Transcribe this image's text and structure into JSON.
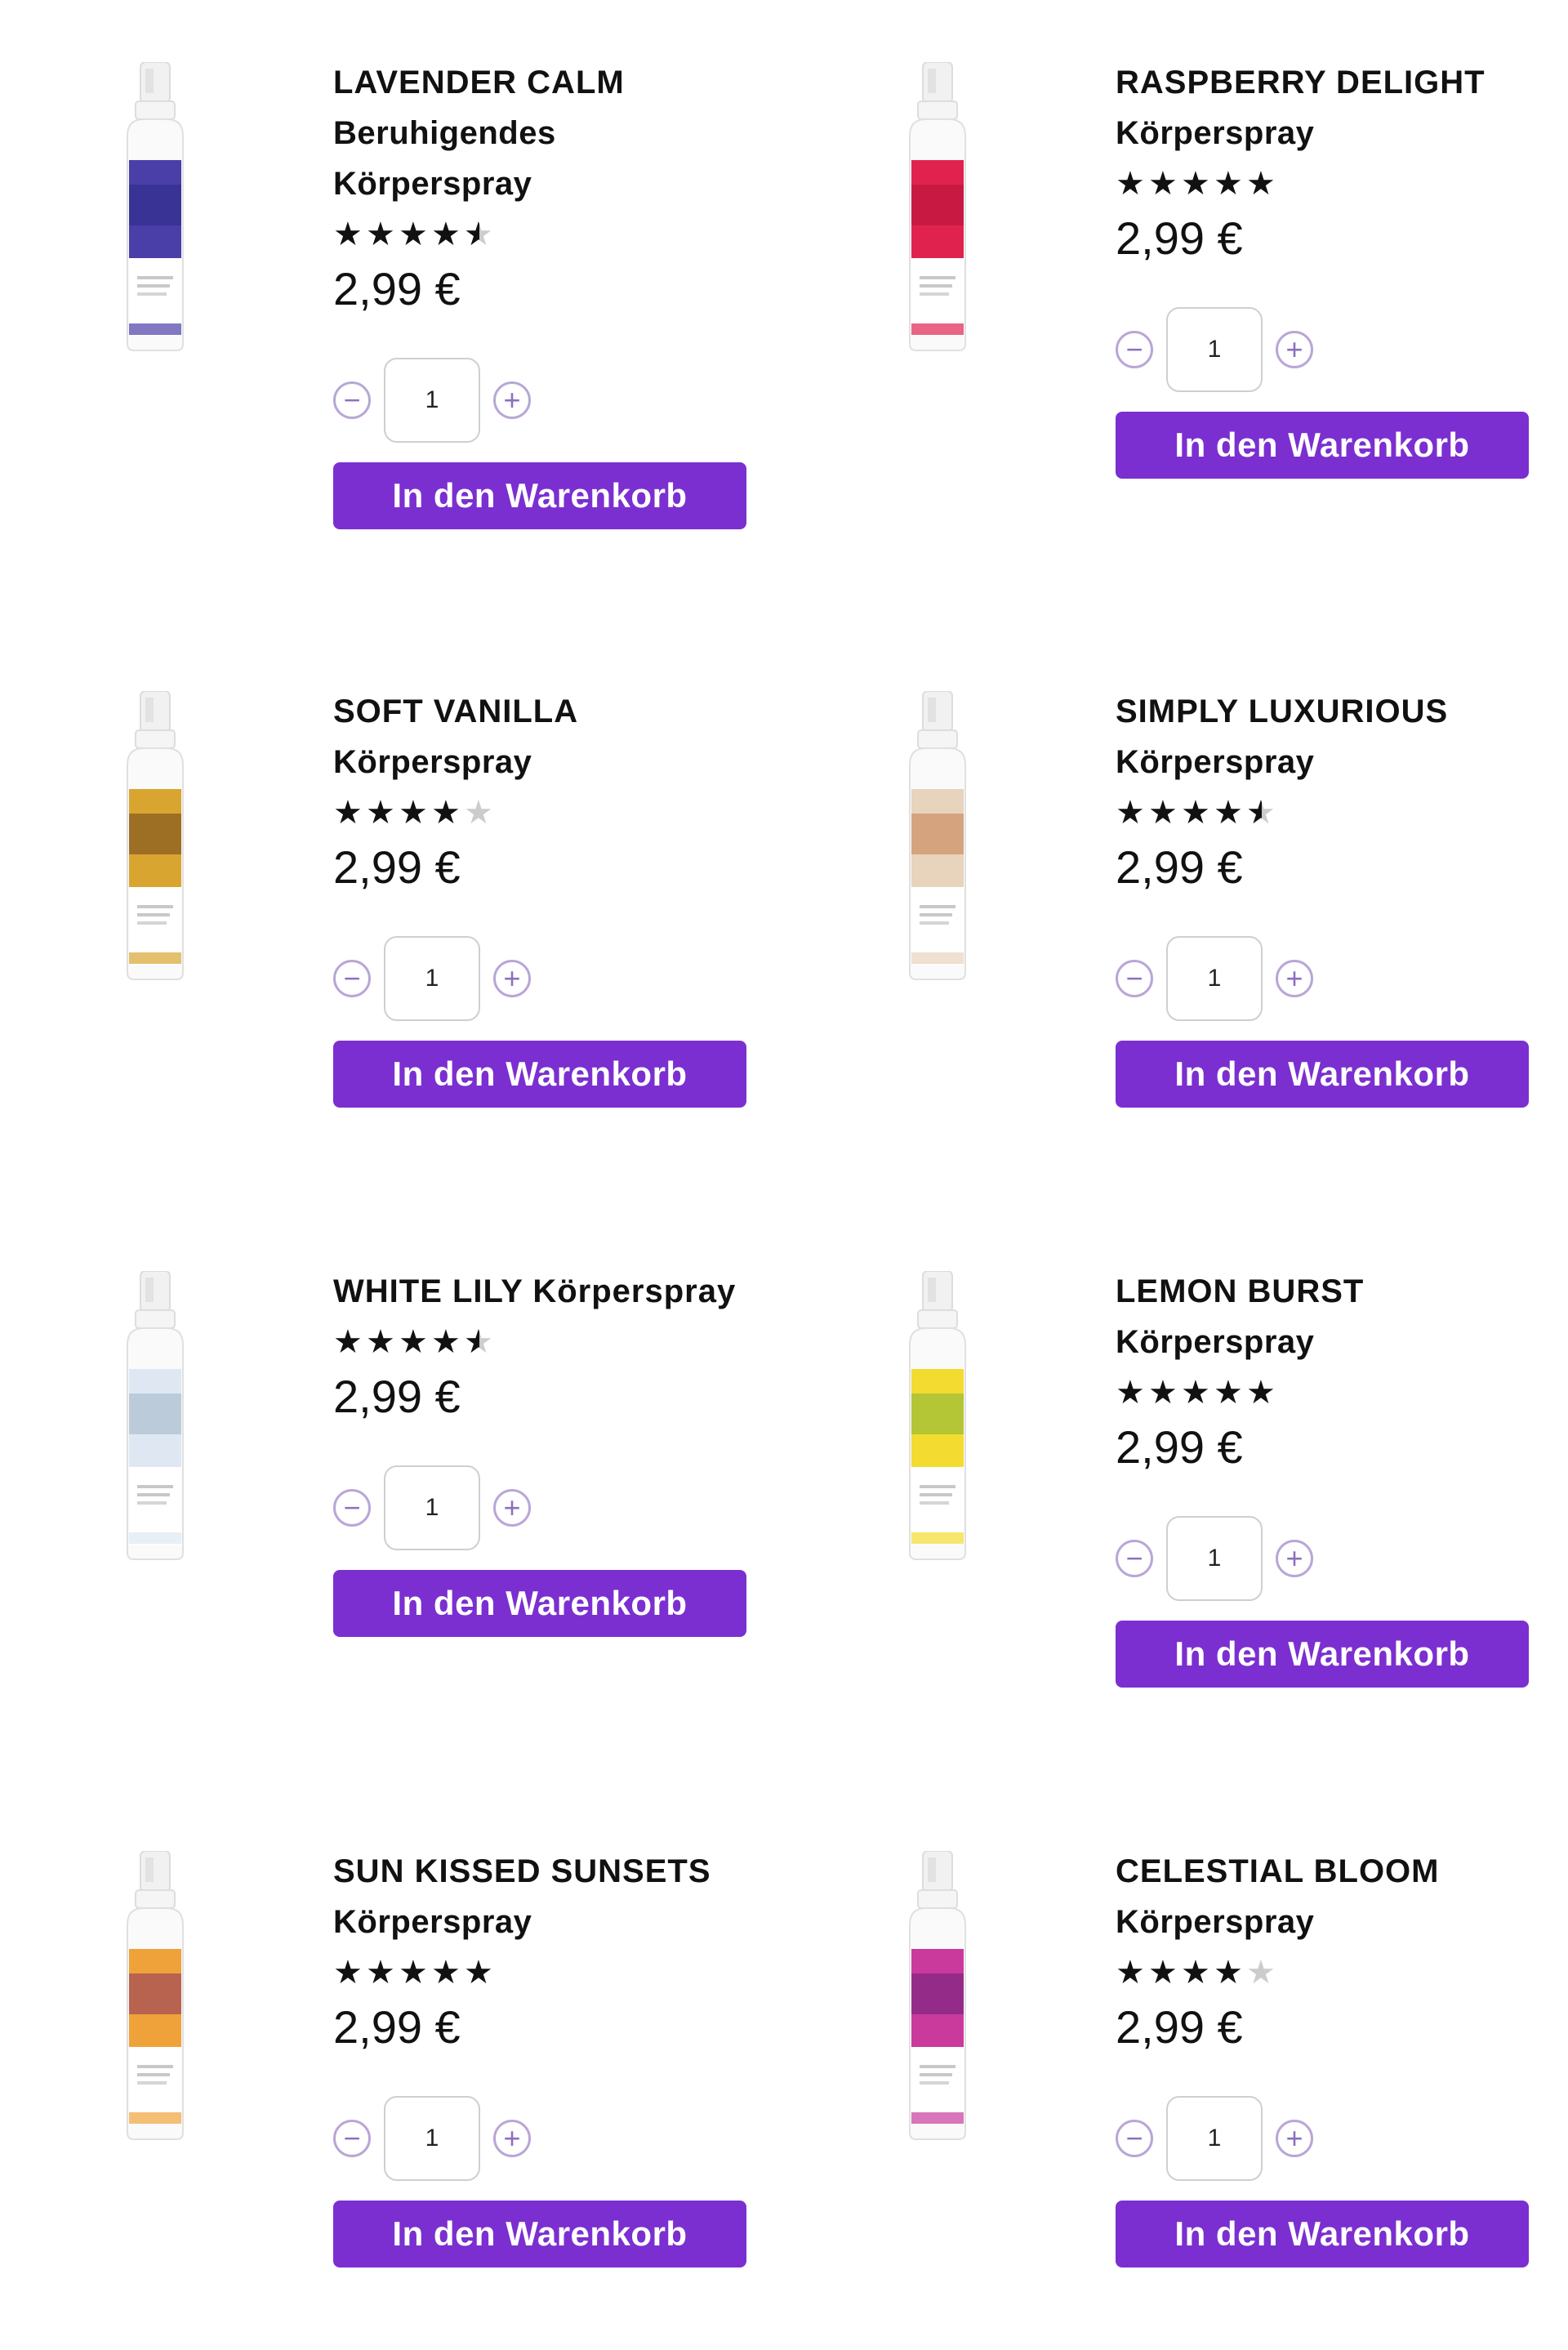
{
  "products": [
    {
      "name": "LAVENDER CALM",
      "subtitle_lines": [
        "Beruhigendes",
        "Körperspray"
      ],
      "rating": 4.5,
      "price": "2,99 €",
      "quantity": "1",
      "cart_label": "In den Warenkorb",
      "label_color": "#4a3fa8",
      "accent_color": "#2e2a86"
    },
    {
      "name": "RASPBERRY DELIGHT",
      "subtitle_lines": [
        "Körperspray"
      ],
      "rating": 5,
      "price": "2,99 €",
      "quantity": "1",
      "cart_label": "In den Warenkorb",
      "label_color": "#e0234e",
      "accent_color": "#b5123a"
    },
    {
      "name": "SOFT VANILLA",
      "subtitle_lines": [
        "Körperspray"
      ],
      "rating": 4,
      "price": "2,99 €",
      "quantity": "1",
      "cart_label": "In den Warenkorb",
      "label_color": "#d9a531",
      "accent_color": "#6b4419"
    },
    {
      "name": "SIMPLY LUXURIOUS",
      "subtitle_lines": [
        "Körperspray"
      ],
      "rating": 4.5,
      "price": "2,99 €",
      "quantity": "1",
      "cart_label": "In den Warenkorb",
      "label_color": "#e8d3bd",
      "accent_color": "#c47c4a"
    },
    {
      "name": "WHITE LILY Körperspray",
      "subtitle_lines": [],
      "rating": 4.5,
      "price": "2,99 €",
      "quantity": "1",
      "cart_label": "In den Warenkorb",
      "label_color": "#dfe8f2",
      "accent_color": "#9fb3c7"
    },
    {
      "name": "LEMON BURST",
      "subtitle_lines": [
        "Körperspray"
      ],
      "rating": 5,
      "price": "2,99 €",
      "quantity": "1",
      "cart_label": "In den Warenkorb",
      "label_color": "#f3dc2f",
      "accent_color": "#7fb33a"
    },
    {
      "name": "SUN KISSED SUNSETS",
      "subtitle_lines": [
        "Körperspray"
      ],
      "rating": 5,
      "price": "2,99 €",
      "quantity": "1",
      "cart_label": "In den Warenkorb",
      "label_color": "#f0a23a",
      "accent_color": "#8a2f63"
    },
    {
      "name": "CELESTIAL BLOOM",
      "subtitle_lines": [
        "Körperspray"
      ],
      "rating": 4,
      "price": "2,99 €",
      "quantity": "1",
      "cart_label": "In den Warenkorb",
      "label_color": "#c93a9c",
      "accent_color": "#6a1f7a"
    }
  ],
  "colors": {
    "button": "#7b2fd0",
    "qty_border": "#b9a6d6"
  }
}
